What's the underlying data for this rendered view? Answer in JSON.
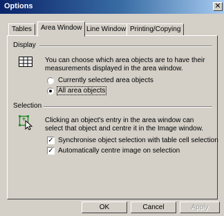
{
  "window": {
    "title": "Options",
    "close_glyph": "✕"
  },
  "tabs": [
    {
      "label": "Tables",
      "active": false
    },
    {
      "label": "Area Window",
      "active": true
    },
    {
      "label": "Line Window",
      "active": false
    },
    {
      "label": "Printing/Copying",
      "active": false
    }
  ],
  "display": {
    "heading": "Display",
    "icon": "table-grid-icon",
    "description_line1": "You can choose which area objects are to have their",
    "description_line2": "measurements displayed in the area window.",
    "options": [
      {
        "label": "Currently selected area objects",
        "selected": false
      },
      {
        "label": "All area objects",
        "selected": true
      }
    ]
  },
  "selection": {
    "heading": "Selection",
    "icon": "cursor-select-icon",
    "description_line1": "Clicking an object's entry in the area window can",
    "description_line2": "select that object and centre it in the Image window.",
    "checkboxes": [
      {
        "label": "Synchronise object selection with table cell selection",
        "checked": true
      },
      {
        "label": "Automatically centre image on selection",
        "checked": true
      }
    ]
  },
  "buttons": {
    "ok": "OK",
    "cancel": "Cancel",
    "apply": "Apply"
  },
  "colors": {
    "face": "#d4d0c8",
    "title_start": "#0a246a",
    "title_end": "#a6caf0",
    "disabled_text": "#a0a0a0",
    "icon_green": "#2e8b2e"
  }
}
